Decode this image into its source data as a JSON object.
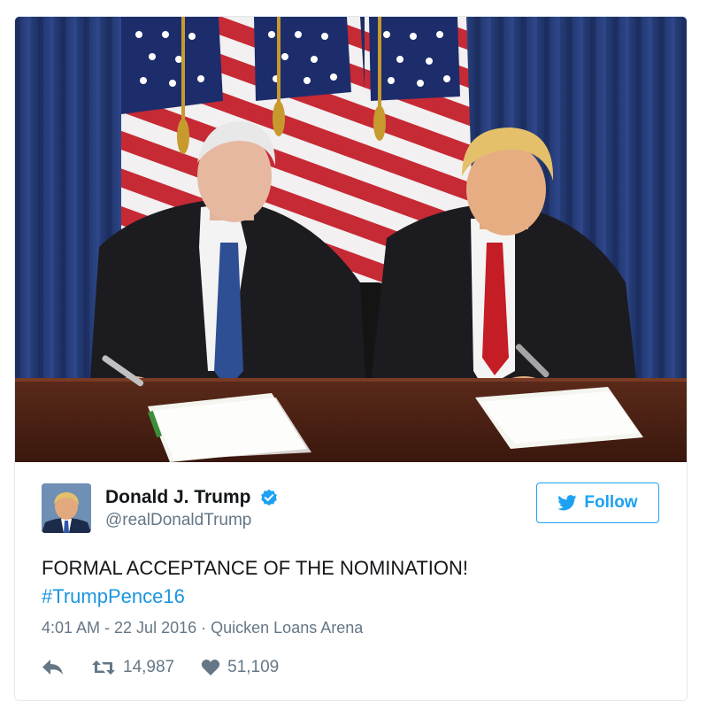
{
  "tweet": {
    "display_name": "Donald J. Trump",
    "screen_name": "@realDonaldTrump",
    "text": "FORMAL ACCEPTANCE OF THE NOMINATION!",
    "hashtag": "#TrumpPence16",
    "timestamp": "4:01 AM - 22 Jul 2016",
    "separator": "·",
    "location": "Quicken Loans Arena",
    "retweet_count": "14,987",
    "like_count": "51,109",
    "verified": true
  },
  "follow_button": {
    "label": "Follow",
    "icon": "twitter-bird-icon"
  },
  "photo": {
    "subject": "two men seated at a wooden desk signing papers in front of american flags"
  },
  "icons": {
    "reply": "reply-icon",
    "retweet": "retweet-icon",
    "like": "heart-icon",
    "verified": "verified-badge-icon"
  },
  "colors": {
    "accent": "#1da1f2",
    "link": "#1b95e0",
    "muted": "#657786",
    "text": "#14171a"
  }
}
